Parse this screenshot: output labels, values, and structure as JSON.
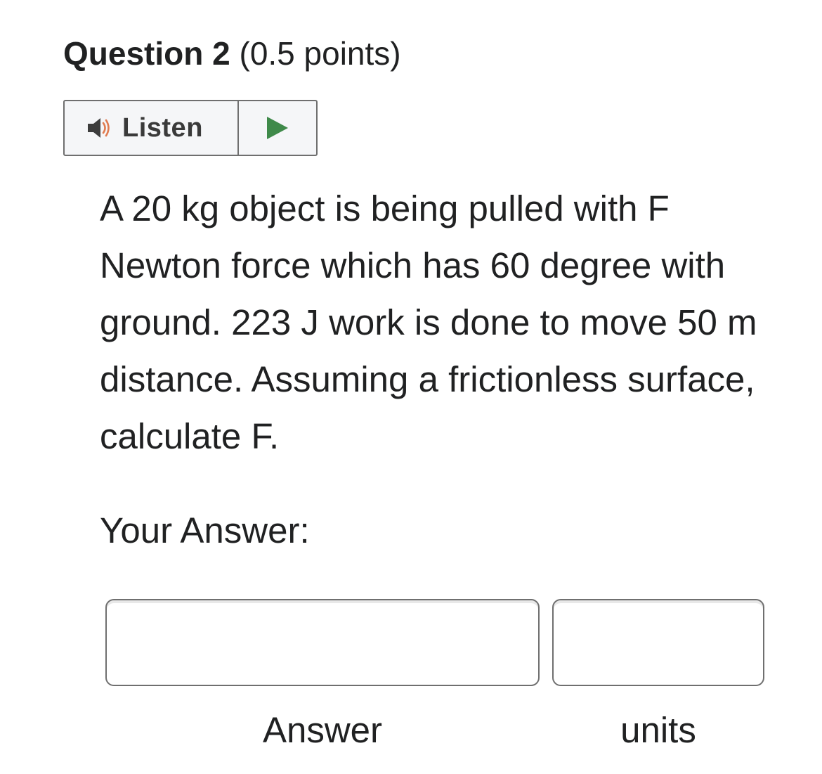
{
  "question": {
    "title": "Question 2",
    "points": "(0.5 points)"
  },
  "listen_widget": {
    "label": "Listen",
    "speaker_icon": "speaker-icon",
    "play_icon": "play-icon",
    "colors": {
      "speaker": "#3d3d3d",
      "sound_waves": "#e07b4f",
      "play": "#3f8a4a"
    }
  },
  "body": {
    "text": "A 20 kg object is being pulled with F Newton force which has 60 degree with ground. 223 J work is done to move 50 m distance. Assuming a frictionless surface, calculate F."
  },
  "answer_section": {
    "label": "Your Answer:",
    "answer_field": {
      "value": "",
      "caption": "Answer"
    },
    "units_field": {
      "value": "",
      "caption": "units"
    }
  }
}
